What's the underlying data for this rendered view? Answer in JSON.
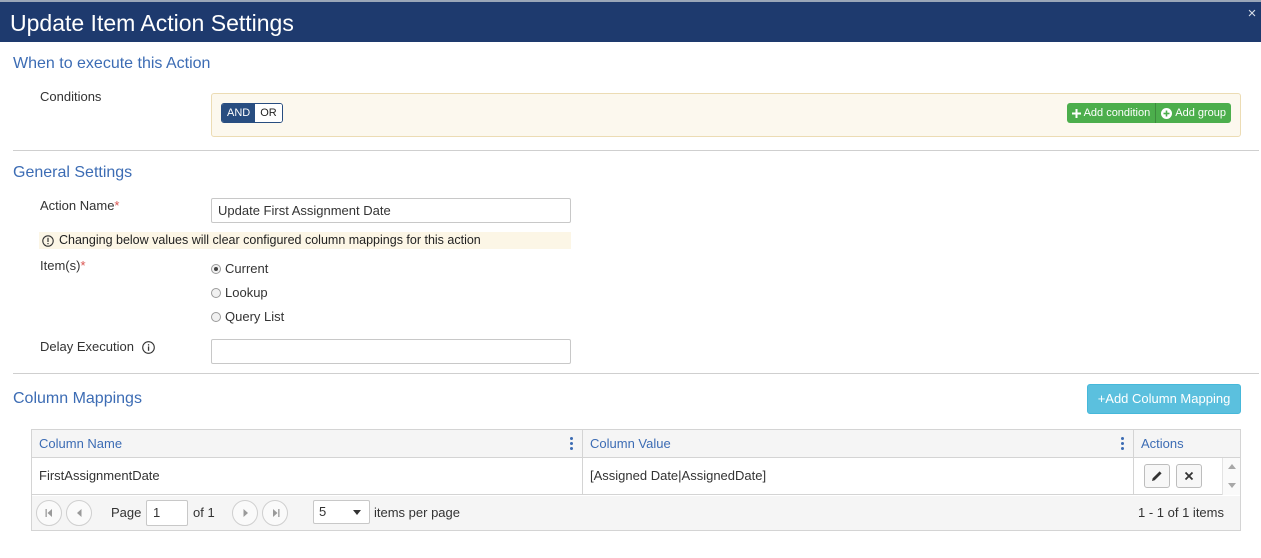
{
  "dialog": {
    "title": "Update Item Action Settings",
    "close_symbol": "×"
  },
  "when_section": {
    "title": "When to execute this Action",
    "conditions_label": "Conditions",
    "logic_and": "AND",
    "logic_or": "OR",
    "add_condition_label": "Add condition",
    "add_group_label": "Add group"
  },
  "general_section": {
    "title": "General Settings",
    "action_name_label": "Action Name",
    "required_mark": "*",
    "action_name_value": "Update First Assignment Date",
    "warning_text": "Changing below values will clear configured column mappings for this action",
    "items_label": "Item(s)",
    "item_options": [
      {
        "label": "Current",
        "checked": true
      },
      {
        "label": "Lookup",
        "checked": false
      },
      {
        "label": "Query List",
        "checked": false
      }
    ],
    "delay_label": "Delay Execution",
    "delay_value": ""
  },
  "mappings_section": {
    "title": "Column Mappings",
    "add_mapping_label": "+Add Column Mapping",
    "columns": [
      "Column Name",
      "Column Value",
      "Actions"
    ],
    "rows": [
      {
        "column_name": "FirstAssignmentDate",
        "column_value": "[Assigned Date|AssignedDate]"
      }
    ],
    "pager": {
      "page_label": "Page",
      "page_value": "1",
      "of_label": "of 1",
      "page_size": "5",
      "per_page_label": "items per page",
      "summary": "1 - 1 of 1 items"
    }
  },
  "colors": {
    "header_bg": "#1e3a6e",
    "section_title": "#3c6cb4",
    "green_button": "#4cae4c",
    "info_button": "#5bc0de",
    "required": "#d9534f"
  }
}
